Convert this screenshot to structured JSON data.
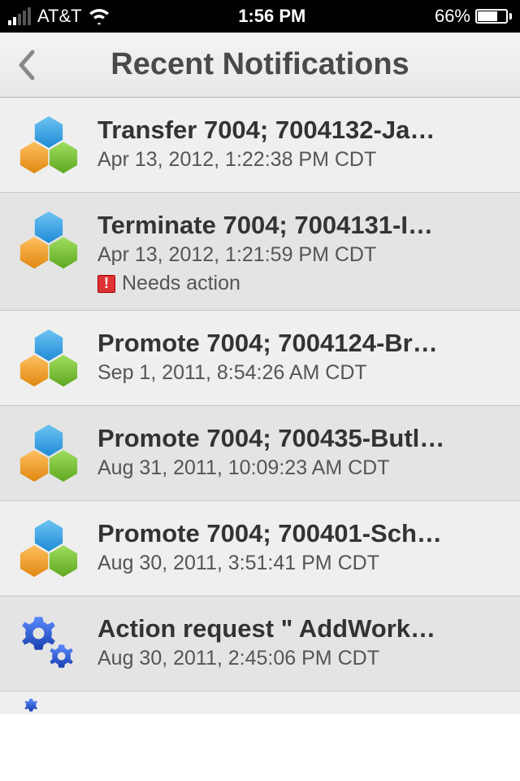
{
  "status_bar": {
    "carrier": "AT&T",
    "time": "1:56 PM",
    "battery_pct": "66%"
  },
  "header": {
    "title": "Recent Notifications"
  },
  "notifications": [
    {
      "icon": "hex",
      "title": "Transfer 7004; 7004132-Ja…",
      "timestamp": "Apr 13, 2012, 1:22:38 PM CDT",
      "needs_action": false
    },
    {
      "icon": "hex",
      "title": "Terminate 7004; 7004131-I…",
      "timestamp": "Apr 13, 2012, 1:21:59 PM CDT",
      "needs_action": true,
      "action_label": "Needs action"
    },
    {
      "icon": "hex",
      "title": "Promote 7004; 7004124-Br…",
      "timestamp": "Sep 1, 2011, 8:54:26 AM CDT",
      "needs_action": false
    },
    {
      "icon": "hex",
      "title": "Promote 7004; 700435-Butl…",
      "timestamp": "Aug 31, 2011, 10:09:23 AM CDT",
      "needs_action": false
    },
    {
      "icon": "hex",
      "title": "Promote 7004; 700401-Sch…",
      "timestamp": "Aug 30, 2011, 3:51:41 PM CDT",
      "needs_action": false
    },
    {
      "icon": "gears",
      "title": "Action request \" AddWork…",
      "timestamp": "Aug 30, 2011, 2:45:06 PM CDT",
      "needs_action": false
    }
  ],
  "colors": {
    "hex_blue": "#3ca0e6",
    "hex_orange": "#f0a030",
    "hex_green": "#7cc040",
    "gear_blue": "#2f5fd8",
    "alert_red": "#d33"
  }
}
